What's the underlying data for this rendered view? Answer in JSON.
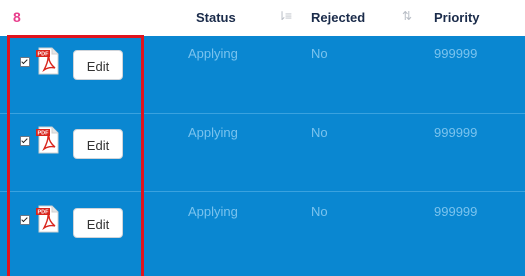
{
  "header": {
    "selection_count": "8",
    "columns": [
      "Status",
      "Rejected",
      "Priority"
    ],
    "sort_icons": [
      "sort-alpha-asc-icon",
      "sort-icon"
    ]
  },
  "rows": [
    {
      "checked": true,
      "file_icon": "pdf-file-icon",
      "edit_label": "Edit",
      "status": "Applying",
      "rejected": "No",
      "priority": "999999"
    },
    {
      "checked": true,
      "file_icon": "pdf-file-icon",
      "edit_label": "Edit",
      "status": "Applying",
      "rejected": "No",
      "priority": "999999"
    },
    {
      "checked": true,
      "file_icon": "pdf-file-icon",
      "edit_label": "Edit",
      "status": "Applying",
      "rejected": "No",
      "priority": "999999"
    }
  ],
  "colors": {
    "row_background": "#0a87d1",
    "cell_text": "#7ac3ee",
    "badge": "#e83e8c",
    "highlight_border": "#e0141e"
  }
}
